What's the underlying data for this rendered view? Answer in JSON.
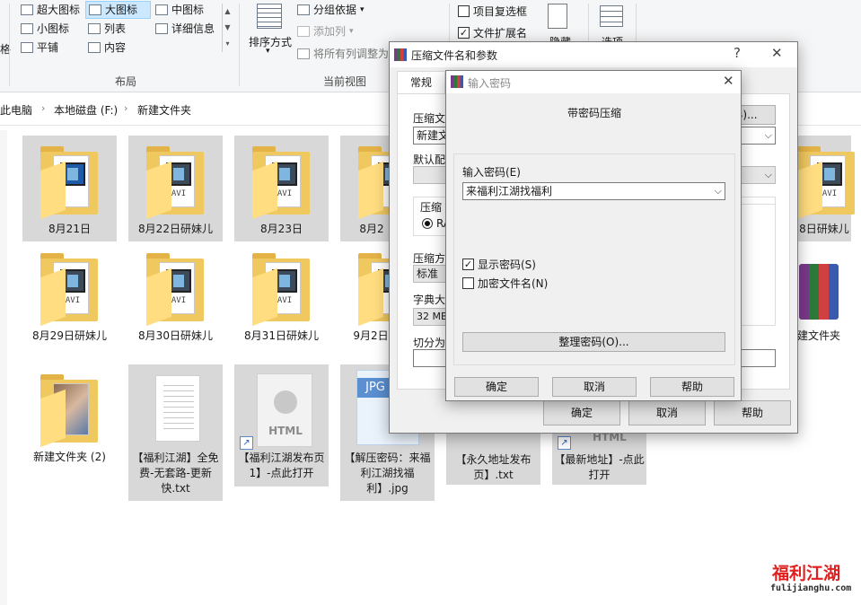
{
  "ribbon": {
    "layout_items": [
      {
        "label": "超大图标",
        "selected": false
      },
      {
        "label": "大图标",
        "selected": true
      },
      {
        "label": "中图标",
        "selected": false
      },
      {
        "label": "小图标",
        "selected": false
      },
      {
        "label": "列表",
        "selected": false
      },
      {
        "label": "详细信息",
        "selected": false
      },
      {
        "label": "平铺",
        "selected": false
      },
      {
        "label": "内容",
        "selected": false
      }
    ],
    "layout_group_label": "布局",
    "sort_label": "排序方式",
    "group_by_label": "分组依据",
    "add_column_label": "添加列",
    "fit_columns_label": "将所有列调整为",
    "current_view_label": "当前视图",
    "item_checkbox_label": "项目复选框",
    "extension_label": "文件扩展名",
    "hide_label": "隐藏",
    "options_label": "选项",
    "left_cut_label": "格"
  },
  "address": {
    "crumbs": [
      "此电脑",
      "本地磁盘 (F:)",
      "新建文件夹"
    ]
  },
  "files": [
    {
      "name": "8月21日",
      "type": "folder-audio"
    },
    {
      "name": "8月22日研妹儿",
      "type": "folder-avi"
    },
    {
      "name": "8月23日",
      "type": "folder-avi"
    },
    {
      "name": "8月2",
      "type": "folder-avi"
    },
    {
      "name": "8日研妹儿",
      "type": "folder-avi"
    },
    {
      "name": "8月29日研妹儿",
      "type": "folder-avi"
    },
    {
      "name": "8月30日研妹儿",
      "type": "folder-avi"
    },
    {
      "name": "8月31日研妹儿",
      "type": "folder-avi"
    },
    {
      "name": "9月2日",
      "type": "folder-avi"
    },
    {
      "name": "建文件夹",
      "type": "winrar"
    },
    {
      "name": "新建文件夹 (2)",
      "type": "folder-photo"
    },
    {
      "name": "【福利江湖】全免费-无套路-更新快.txt",
      "type": "txt"
    },
    {
      "name": "【福利江湖发布页1】-点此打开",
      "type": "html"
    },
    {
      "name": "【解压密码：来福利江湖找福利】.jpg",
      "type": "jpg"
    },
    {
      "name": "【永久地址发布页】.txt",
      "type": "txt"
    },
    {
      "name": "【最新地址】-点此打开",
      "type": "html"
    }
  ],
  "icons": {
    "html_text": "HTML",
    "jpg_text": "JPG",
    "avi_text": "AVI"
  },
  "dialog_archive": {
    "title": "压缩文件名和参数",
    "help_glyph": "?",
    "close_glyph": "✕",
    "tab_general": "常规",
    "archive_name_label": "压缩文",
    "archive_name_value": "新建文",
    "browse_label": "(B)...",
    "default_profile_label": "默认配",
    "format_label": "压缩",
    "rar_label": "RA",
    "method_label": "压缩方",
    "method_value": "标准",
    "dict_label": "字典大",
    "dict_value": "32 MB",
    "split_label": "切分为",
    "ok": "确定",
    "cancel": "取消",
    "help": "帮助"
  },
  "dialog_password": {
    "title": "输入密码",
    "close_glyph": "✕",
    "heading": "带密码压缩",
    "password_label": "输入密码(E)",
    "password_value": "来福利江湖找福利",
    "show_password_label": "显示密码(S)",
    "show_password_checked": true,
    "encrypt_names_label": "加密文件名(N)",
    "encrypt_names_checked": false,
    "organize_label": "整理密码(O)...",
    "ok": "确定",
    "cancel": "取消",
    "help": "帮助"
  },
  "watermark": {
    "cn": "福利江湖",
    "url": "fulijianghu.com"
  }
}
